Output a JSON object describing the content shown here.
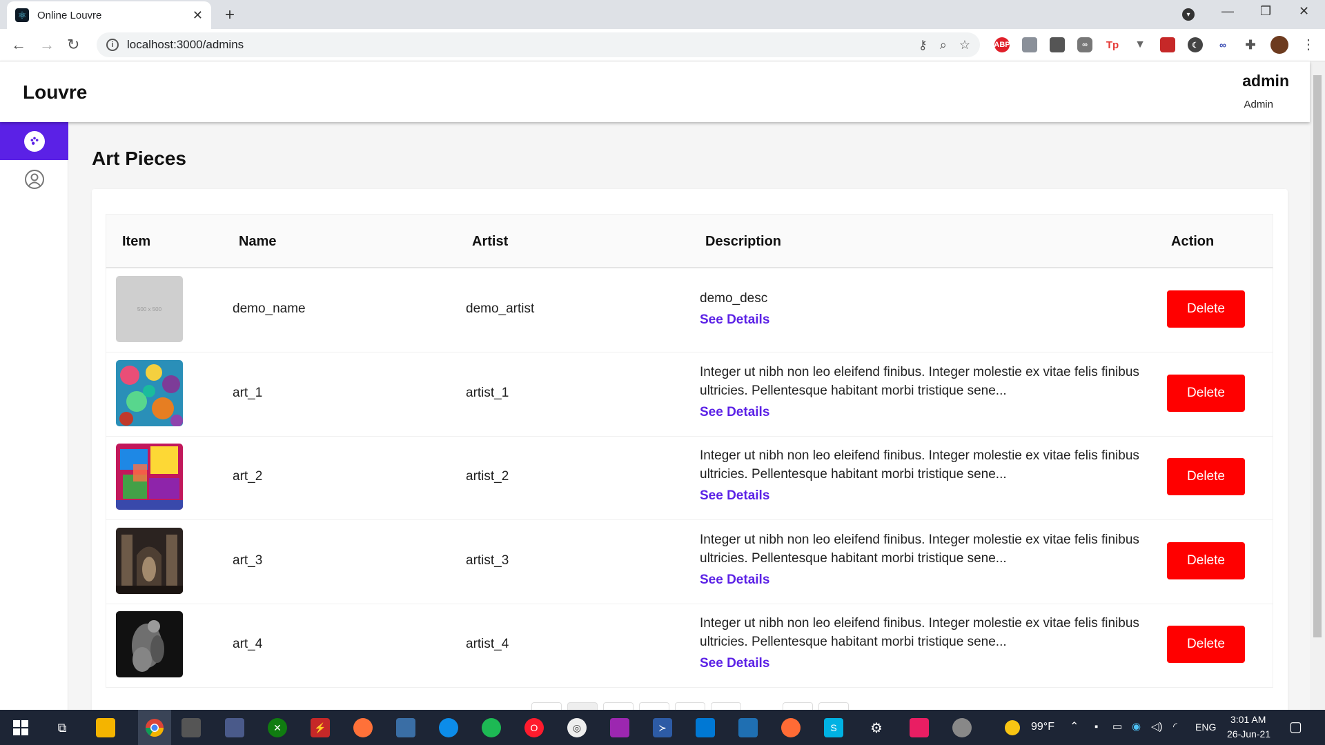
{
  "browser": {
    "tab_title": "Online Louvre",
    "url": "localhost:3000/admins",
    "extensions": [
      "ABP",
      "Tp"
    ]
  },
  "header": {
    "brand": "Louvre",
    "user_name": "admin",
    "user_role": "Admin"
  },
  "sidebar": {
    "items": [
      {
        "icon": "palette-icon",
        "active": true
      },
      {
        "icon": "user-icon",
        "active": false
      }
    ]
  },
  "main": {
    "title": "Art Pieces",
    "columns": [
      "Item",
      "Name",
      "Artist",
      "Description",
      "Action"
    ],
    "rows": [
      {
        "thumb_text": "500 x 500",
        "name": "demo_name",
        "artist": "demo_artist",
        "description": "demo_desc",
        "link": "See Details",
        "action": "Delete"
      },
      {
        "thumb_text": "",
        "name": "art_1",
        "artist": "artist_1",
        "description": "Integer ut nibh non leo eleifend finibus. Integer molestie ex vitae felis finibus ultricies. Pellentesque habitant morbi tristique sene...",
        "link": "See Details",
        "action": "Delete"
      },
      {
        "thumb_text": "",
        "name": "art_2",
        "artist": "artist_2",
        "description": "Integer ut nibh non leo eleifend finibus. Integer molestie ex vitae felis finibus ultricies. Pellentesque habitant morbi tristique sene...",
        "link": "See Details",
        "action": "Delete"
      },
      {
        "thumb_text": "",
        "name": "art_3",
        "artist": "artist_3",
        "description": "Integer ut nibh non leo eleifend finibus. Integer molestie ex vitae felis finibus ultricies. Pellentesque habitant morbi tristique sene...",
        "link": "See Details",
        "action": "Delete"
      },
      {
        "thumb_text": "",
        "name": "art_4",
        "artist": "artist_4",
        "description": "Integer ut nibh non leo eleifend finibus. Integer molestie ex vitae felis finibus ultricies. Pellentesque habitant morbi tristique sene...",
        "link": "See Details",
        "action": "Delete"
      }
    ]
  },
  "taskbar": {
    "weather": "99°F",
    "language": "ENG",
    "time": "3:01 AM",
    "date": "26-Jun-21"
  },
  "colors": {
    "accent": "#5b21e6",
    "danger": "#ff0000"
  }
}
